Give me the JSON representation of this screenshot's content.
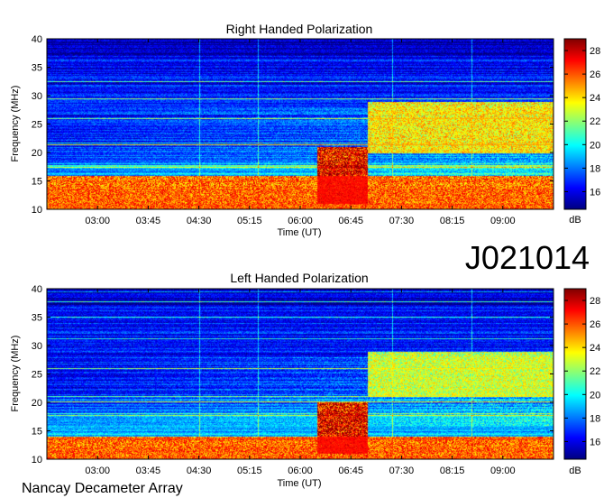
{
  "dataset_id": "J021014",
  "footer": "Nancay Decameter Array",
  "colorscale": {
    "unit": "dB",
    "range": [
      14.5,
      29
    ],
    "ticks": [
      16,
      18,
      20,
      22,
      24,
      26,
      28
    ],
    "colors": [
      "#00007f",
      "#0000ff",
      "#007fff",
      "#00ffff",
      "#7fff7f",
      "#ffff00",
      "#ff7f00",
      "#ff0000",
      "#7f0000"
    ]
  },
  "chart_data": [
    {
      "type": "heatmap",
      "title": "Right Handed Polarization",
      "xlabel": "Time (UT)",
      "ylabel": "Frequency (MHz)",
      "xlim": [
        "02:15",
        "09:45"
      ],
      "ylim": [
        10,
        40
      ],
      "xticks": [
        "03:00",
        "03:45",
        "04:30",
        "05:15",
        "06:00",
        "06:45",
        "07:30",
        "08:15",
        "09:00"
      ],
      "yticks": [
        10,
        15,
        20,
        25,
        30,
        35,
        40
      ],
      "colorbar_unit": "dB",
      "features": [
        {
          "label": "intense emission block",
          "t_start": "06:15",
          "t_end": "07:00",
          "f_start": 11,
          "f_end": 21,
          "level_db": 29
        },
        {
          "label": "low-frequency band",
          "t_start": "02:15",
          "t_end": "09:45",
          "f_start": 10,
          "f_end": 16,
          "level_db": 27
        },
        {
          "label": "upper burst region",
          "t_start": "07:00",
          "t_end": "09:45",
          "f_start": 20,
          "f_end": 29,
          "level_db": 25
        }
      ]
    },
    {
      "type": "heatmap",
      "title": "Left Handed Polarization",
      "xlabel": "Time (UT)",
      "ylabel": "Frequency (MHz)",
      "xlim": [
        "02:15",
        "09:45"
      ],
      "ylim": [
        10,
        40
      ],
      "xticks": [
        "03:00",
        "03:45",
        "04:30",
        "05:15",
        "06:00",
        "06:45",
        "07:30",
        "08:15",
        "09:00"
      ],
      "yticks": [
        10,
        15,
        20,
        25,
        30,
        35,
        40
      ],
      "colorbar_unit": "dB",
      "features": [
        {
          "label": "intense emission block",
          "t_start": "06:15",
          "t_end": "07:00",
          "f_start": 11,
          "f_end": 20,
          "level_db": 29
        },
        {
          "label": "low-frequency band",
          "t_start": "02:15",
          "t_end": "09:45",
          "f_start": 10,
          "f_end": 14,
          "level_db": 27
        },
        {
          "label": "upper burst region",
          "t_start": "07:00",
          "t_end": "09:45",
          "f_start": 21,
          "f_end": 29,
          "level_db": 24
        }
      ]
    }
  ]
}
